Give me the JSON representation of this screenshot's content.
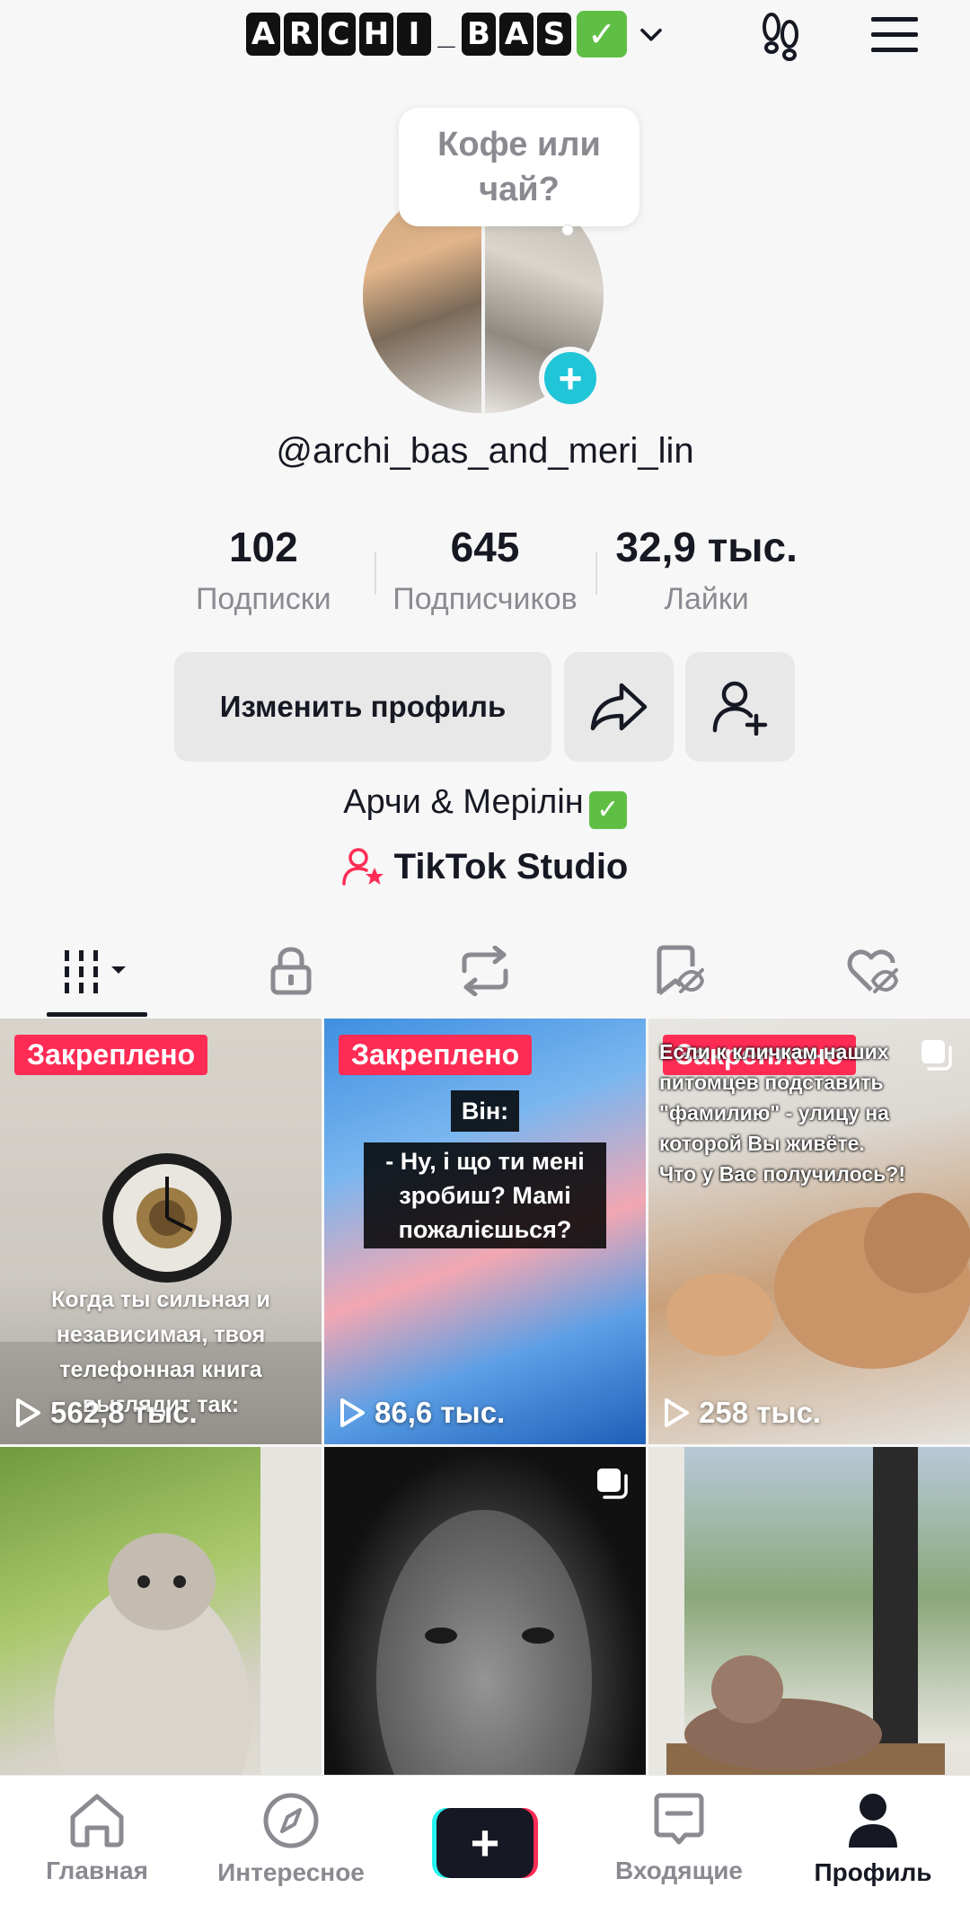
{
  "header": {
    "username_letters": [
      "A",
      "R",
      "C",
      "H",
      "I",
      "_",
      "B",
      "A",
      "S"
    ],
    "verified_mark": "✓",
    "icons": [
      "chevron-down-icon",
      "footprints-icon",
      "menu-icon"
    ]
  },
  "profile": {
    "bubble_text": "Кофе или\nчай?",
    "handle": "@archi_bas_and_meri_lin",
    "stats": [
      {
        "value": "102",
        "label": "Подписки"
      },
      {
        "value": "645",
        "label": "Подписчиков"
      },
      {
        "value": "32,9 тыс.",
        "label": "Лайки"
      }
    ],
    "edit_label": "Изменить профиль",
    "bio": "Арчи & Мерілін",
    "studio_label": "TikTok Studio"
  },
  "tabs": [
    "videos-grid-icon",
    "lock-icon",
    "repost-icon",
    "bookmark-hidden-icon",
    "liked-hidden-icon"
  ],
  "videos": [
    {
      "pinned": "Закреплено",
      "views": "562,8 тыс.",
      "caption": "Когда ты сильная и\nнезависимая, твоя\nтелефонная книга\nвыглядит так:"
    },
    {
      "pinned": "Закреплено",
      "views": "86,6 тыс.",
      "caption_top": "Він:",
      "caption_main": "- Ну, і що ти мені\nзробиш? Мамі\nпожалієшься?"
    },
    {
      "pinned": "Закреплено",
      "views": "258 тыс.",
      "caption": "Если к кличкам наших\nпитомцев подставить\n\"фамилию\" - улицу на\nкоторой Вы живёте.\nЧто у Вас получилось?!"
    },
    {
      "views": ""
    },
    {
      "views": ""
    },
    {
      "views": ""
    }
  ],
  "bottom_nav": {
    "home": "Главная",
    "discover": "Интересное",
    "create": "+",
    "inbox": "Входящие",
    "profile": "Профиль"
  },
  "colors": {
    "accent_pink": "#fe2c55",
    "accent_cyan": "#25f4ee",
    "add_avatar": "#20c5d8",
    "verified_green": "#5fbf45"
  }
}
